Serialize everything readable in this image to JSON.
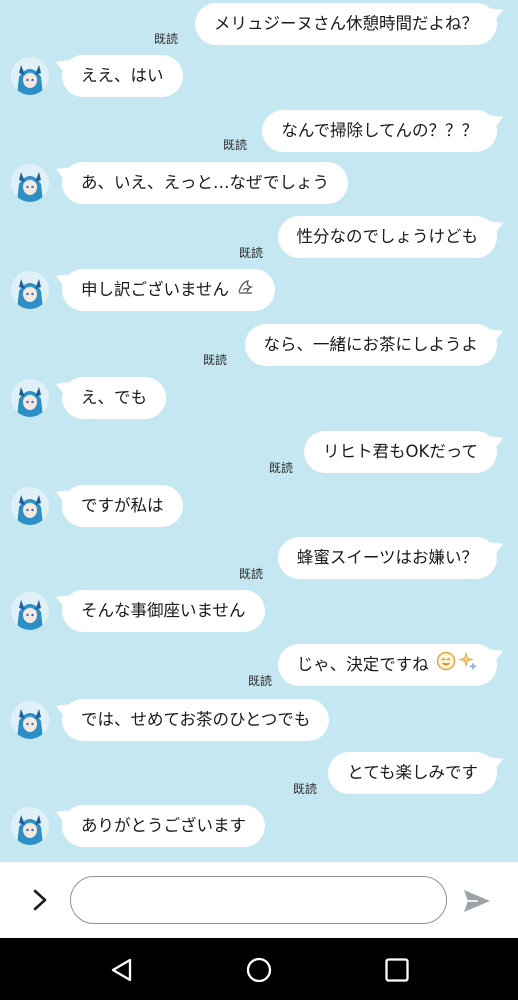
{
  "messages": [
    {
      "id": 1,
      "side": "out",
      "read": "既読",
      "text": "メリュジーヌさん休憩時間だよね？"
    },
    {
      "id": 2,
      "side": "in",
      "text": "ええ、はい"
    },
    {
      "id": 3,
      "side": "out",
      "read": "既読",
      "text": "なんで掃除してんの？？？"
    },
    {
      "id": 4,
      "side": "in",
      "text": "あ、いえ、えっと…なぜでしょう"
    },
    {
      "id": 5,
      "side": "out",
      "read": "既読",
      "text": "性分なのでしょうけども"
    },
    {
      "id": 6,
      "side": "in",
      "text": "申し訳ございません",
      "emoji": "wilted-drop-emoji"
    },
    {
      "id": 7,
      "side": "out",
      "read": "既読",
      "text": "なら、一緒にお茶にしようよ"
    },
    {
      "id": 8,
      "side": "in",
      "text": "え、でも"
    },
    {
      "id": 9,
      "side": "out",
      "read": "既読",
      "text": "リヒト君もOKだって"
    },
    {
      "id": 10,
      "side": "in",
      "text": "ですが私は"
    },
    {
      "id": 11,
      "side": "out",
      "read": "既読",
      "text": "蜂蜜スイーツはお嫌い？"
    },
    {
      "id": 12,
      "side": "in",
      "text": "そんな事御座いません"
    },
    {
      "id": 13,
      "side": "out",
      "read": "既読",
      "text": "じゃ、決定ですね",
      "emoji": "smiling-face-sparkles-emoji"
    },
    {
      "id": 14,
      "side": "in",
      "text": "では、せめてお茶のひとつでも"
    },
    {
      "id": 15,
      "side": "out",
      "read": "既読",
      "text": "とても楽しみです"
    },
    {
      "id": 16,
      "side": "in",
      "text": "ありがとうございます"
    }
  ],
  "input": {
    "placeholder": "",
    "value": ""
  },
  "icons": {
    "expand": "chevron-right-icon",
    "send": "send-arrow-icon",
    "nav_back": "triangle-back-icon",
    "nav_home": "circle-home-icon",
    "nav_recents": "square-recents-icon"
  },
  "colors": {
    "chat_background": "#c5e7f1",
    "bubble": "#ffffff",
    "nav_bar": "#000000",
    "send_icon": "#9aa3a8"
  }
}
